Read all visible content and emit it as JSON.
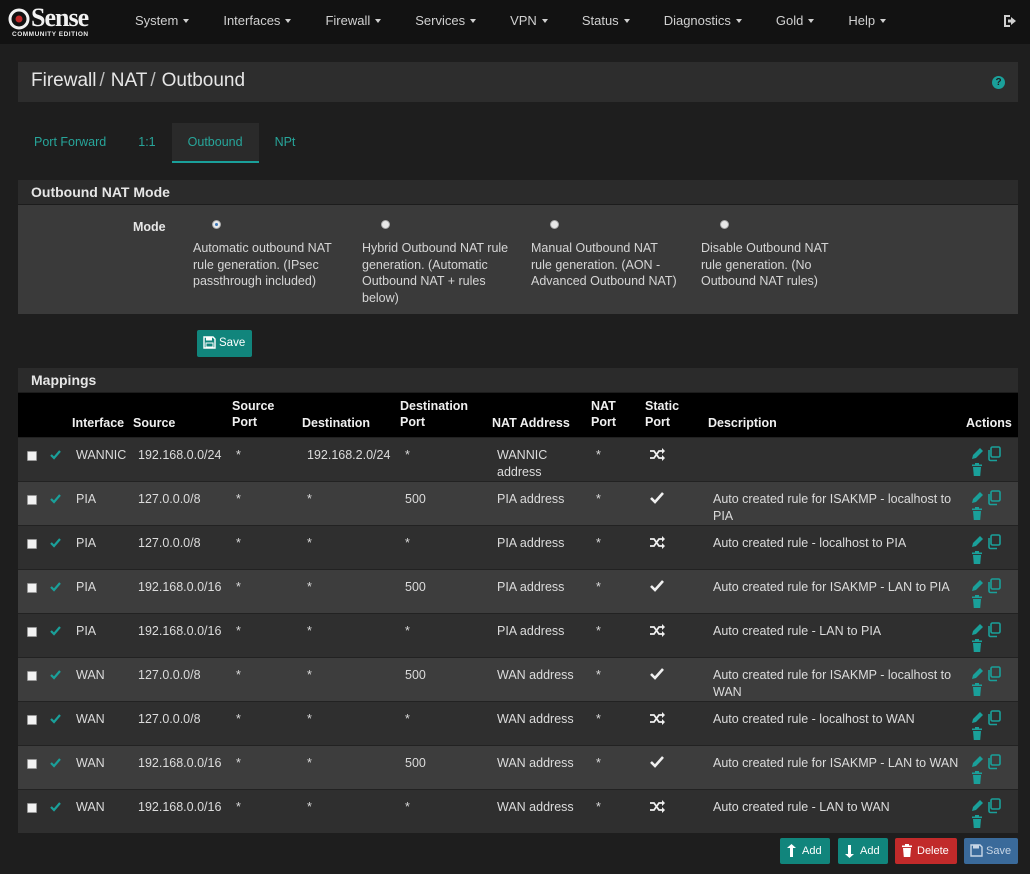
{
  "navbar": {
    "logo_main": "Sense",
    "logo_sub": "COMMUNITY EDITION",
    "menu": [
      "System",
      "Interfaces",
      "Firewall",
      "Services",
      "VPN",
      "Status",
      "Diagnostics",
      "Gold",
      "Help"
    ]
  },
  "breadcrumb": [
    "Firewall",
    "NAT",
    "Outbound"
  ],
  "tabs": [
    "Port Forward",
    "1:1",
    "Outbound",
    "NPt"
  ],
  "active_tab": "Outbound",
  "mode_panel": {
    "title": "Outbound NAT Mode",
    "label": "Mode",
    "options": [
      {
        "text": "Automatic outbound NAT rule generation. (IPsec passthrough included)",
        "checked": true
      },
      {
        "text": "Hybrid Outbound NAT rule generation. (Automatic Outbound NAT + rules below)",
        "checked": false
      },
      {
        "text": "Manual Outbound NAT rule generation. (AON - Advanced Outbound NAT)",
        "checked": false
      },
      {
        "text": "Disable Outbound NAT rule generation. (No Outbound NAT rules)",
        "checked": false
      }
    ],
    "save_label": "Save"
  },
  "mappings": {
    "title": "Mappings",
    "columns": {
      "interface": "Interface",
      "source": "Source",
      "source_port": "Source Port",
      "destination": "Destination",
      "destination_port": "Destination Port",
      "nat_address": "NAT Address",
      "nat_port": "NAT Port",
      "static_port": "Static Port",
      "description": "Description",
      "actions": "Actions"
    },
    "rows": [
      {
        "interface": "WANNIC",
        "source": "192.168.0.0/24",
        "source_port": "*",
        "destination": "192.168.2.0/24",
        "destination_port": "*",
        "nat_address": "WANNIC address",
        "nat_port": "*",
        "static_port": "shuffle",
        "description": ""
      },
      {
        "interface": "PIA",
        "source": "127.0.0.0/8",
        "source_port": "*",
        "destination": "*",
        "destination_port": "500",
        "nat_address": "PIA address",
        "nat_port": "*",
        "static_port": "check",
        "description": "Auto created rule for ISAKMP - localhost to PIA"
      },
      {
        "interface": "PIA",
        "source": "127.0.0.0/8",
        "source_port": "*",
        "destination": "*",
        "destination_port": "*",
        "nat_address": "PIA address",
        "nat_port": "*",
        "static_port": "shuffle",
        "description": "Auto created rule - localhost to PIA"
      },
      {
        "interface": "PIA",
        "source": "192.168.0.0/16",
        "source_port": "*",
        "destination": "*",
        "destination_port": "500",
        "nat_address": "PIA address",
        "nat_port": "*",
        "static_port": "check",
        "description": "Auto created rule for ISAKMP - LAN to PIA"
      },
      {
        "interface": "PIA",
        "source": "192.168.0.0/16",
        "source_port": "*",
        "destination": "*",
        "destination_port": "*",
        "nat_address": "PIA address",
        "nat_port": "*",
        "static_port": "shuffle",
        "description": "Auto created rule - LAN to PIA"
      },
      {
        "interface": "WAN",
        "source": "127.0.0.0/8",
        "source_port": "*",
        "destination": "*",
        "destination_port": "500",
        "nat_address": "WAN address",
        "nat_port": "*",
        "static_port": "check",
        "description": "Auto created rule for ISAKMP - localhost to WAN"
      },
      {
        "interface": "WAN",
        "source": "127.0.0.0/8",
        "source_port": "*",
        "destination": "*",
        "destination_port": "*",
        "nat_address": "WAN address",
        "nat_port": "*",
        "static_port": "shuffle",
        "description": "Auto created rule - localhost to WAN"
      },
      {
        "interface": "WAN",
        "source": "192.168.0.0/16",
        "source_port": "*",
        "destination": "*",
        "destination_port": "500",
        "nat_address": "WAN address",
        "nat_port": "*",
        "static_port": "check",
        "description": "Auto created rule for ISAKMP - LAN to WAN"
      },
      {
        "interface": "WAN",
        "source": "192.168.0.0/16",
        "source_port": "*",
        "destination": "*",
        "destination_port": "*",
        "nat_address": "WAN address",
        "nat_port": "*",
        "static_port": "shuffle",
        "description": "Auto created rule - LAN to WAN"
      }
    ]
  },
  "footer_buttons": {
    "add_top": "Add",
    "add_bottom": "Add",
    "delete": "Delete",
    "save": "Save"
  },
  "colors": {
    "accent": "#1aa09a",
    "danger": "#c12a2a",
    "navbar": "#121212"
  }
}
